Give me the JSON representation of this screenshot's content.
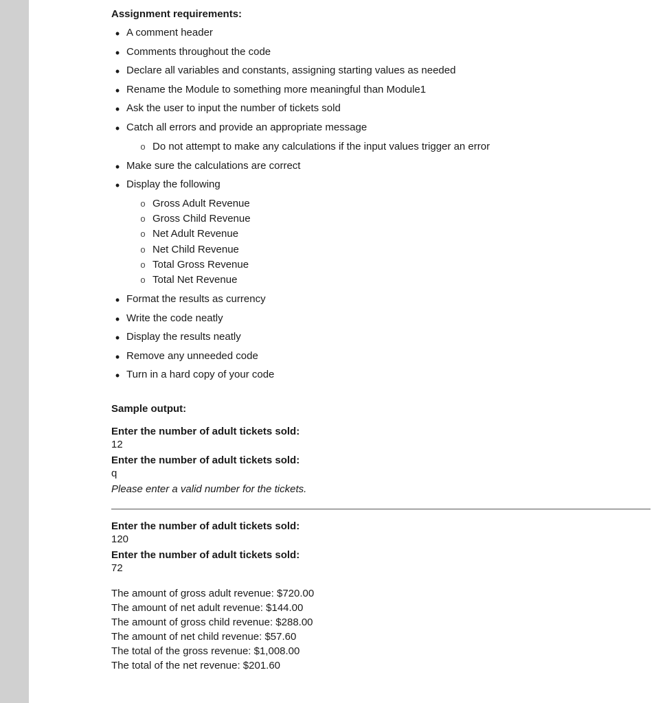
{
  "page": {
    "assignment_heading": "Assignment requirements:",
    "requirements": [
      {
        "text": "A comment header"
      },
      {
        "text": "Comments throughout the code"
      },
      {
        "text": "Declare all variables and constants, assigning starting values as needed"
      },
      {
        "text": "Rename the Module to something more meaningful than Module1"
      },
      {
        "text": "Ask the user to input the number of tickets sold"
      },
      {
        "text": "Catch all errors and provide an appropriate message",
        "sub": [
          "Do not attempt to make any calculations if the input values trigger an error"
        ]
      },
      {
        "text": "Make sure the calculations are correct"
      },
      {
        "text": "Display the following",
        "sub": [
          "Gross Adult Revenue",
          "Gross Child Revenue",
          "Net Adult Revenue",
          "Net Child Revenue",
          "Total Gross Revenue",
          "Total Net Revenue"
        ]
      },
      {
        "text": "Format the results as currency"
      },
      {
        "text": "Write the code neatly"
      },
      {
        "text": "Display the results neatly"
      },
      {
        "text": "Remove any unneeded code"
      },
      {
        "text": "Turn in a hard copy of your code"
      }
    ],
    "sample_output_heading": "Sample output:",
    "output_blocks": [
      {
        "label": "Enter the number of adult tickets sold:",
        "value": "12",
        "label2": "Enter the number of adult tickets sold:",
        "value2": "q",
        "error": "Please enter a valid number for the tickets."
      },
      {
        "label": "Enter the number of adult tickets sold:",
        "value": "120",
        "label2": "Enter the number of adult tickets sold:",
        "value2": "72"
      }
    ],
    "revenue_lines": [
      "The amount of gross adult revenue:  $720.00",
      "The amount of net adult revenue:  $144.00",
      "The amount of gross child revenue:  $288.00",
      "The amount of net child revenue:  $57.60",
      "The total of the gross revenue:  $1,008.00",
      "The total of the net revenue:  $201.60"
    ]
  }
}
